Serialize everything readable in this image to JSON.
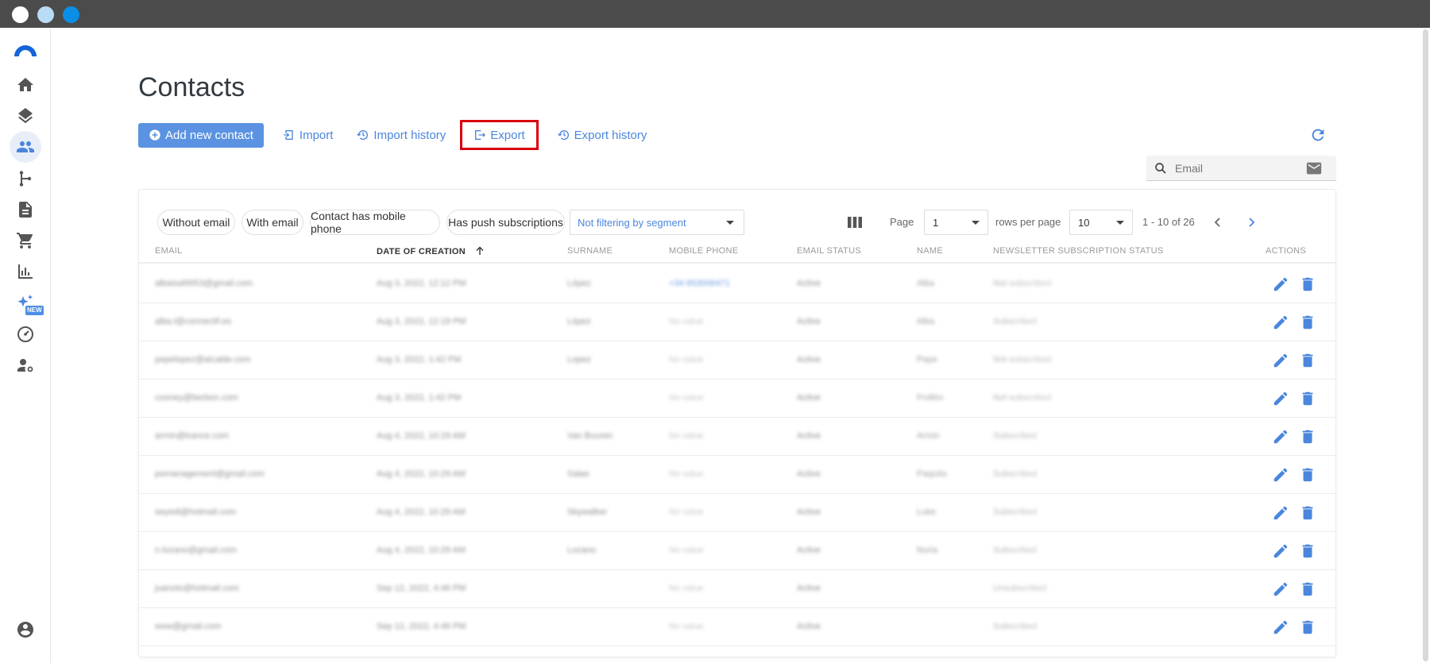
{
  "window": {
    "controls": [
      "close",
      "minimize",
      "maximize"
    ]
  },
  "sidebar": {
    "items": [
      {
        "icon": "home-icon"
      },
      {
        "icon": "layers-icon"
      },
      {
        "icon": "contacts-icon",
        "active": true
      },
      {
        "icon": "flow-icon"
      },
      {
        "icon": "document-icon"
      },
      {
        "icon": "cart-icon"
      },
      {
        "icon": "bar-chart-icon"
      },
      {
        "icon": "sparkles-icon",
        "badge": "NEW"
      },
      {
        "icon": "dashboard-icon"
      },
      {
        "icon": "user-settings-icon"
      }
    ],
    "bottom_icon": "account-icon"
  },
  "page": {
    "title": "Contacts"
  },
  "toolbar": {
    "add_label": "Add new contact",
    "import_label": "Import",
    "import_history_label": "Import history",
    "export_label": "Export",
    "export_history_label": "Export history"
  },
  "search": {
    "placeholder": "Email"
  },
  "filters": {
    "chips": [
      "Without email",
      "With email",
      "Contact has mobile phone",
      "Has push subscriptions"
    ],
    "segment": "Not filtering by segment"
  },
  "pagination": {
    "page_label": "Page",
    "page_value": "1",
    "rows_label": "rows per page",
    "rows_value": "10",
    "range": "1 - 10 of 26"
  },
  "table": {
    "columns": [
      "EMAIL",
      "DATE OF CREATION",
      "SURNAME",
      "MOBILE PHONE",
      "EMAIL STATUS",
      "NAME",
      "NEWSLETTER SUBSCRIPTION STATUS",
      "ACTIONS"
    ],
    "sorted_column": "DATE OF CREATION",
    "rows": [
      {
        "email": "albaisal9953@gmail.com",
        "date": "Aug 3, 2022, 12:12 PM",
        "surname": "López",
        "phone": "+34 653006471",
        "status": "Active",
        "name": "Alba",
        "newsletter": "Not subscribed"
      },
      {
        "email": "alba.l@connectif.es",
        "date": "Aug 3, 2022, 12:19 PM",
        "surname": "López",
        "phone": "No value",
        "status": "Active",
        "name": "Alba",
        "newsletter": "Subscribed"
      },
      {
        "email": "pepelopez@alcalde.com",
        "date": "Aug 3, 2022, 1:42 PM",
        "surname": "Lopez",
        "phone": "No value",
        "status": "Active",
        "name": "Pepe",
        "newsletter": "Not subscribed"
      },
      {
        "email": "cooney@berbon.com",
        "date": "Aug 3, 2022, 1:42 PM",
        "surname": "",
        "phone": "No value",
        "status": "Active",
        "name": "Frollón",
        "newsletter": "Not subscribed"
      },
      {
        "email": "armin@trance.com",
        "date": "Aug 4, 2022, 10:29 AM",
        "surname": "Van Buuren",
        "phone": "No value",
        "status": "Active",
        "name": "Armin",
        "newsletter": "Subscribed"
      },
      {
        "email": "pomanagement@gmail.com",
        "date": "Aug 4, 2022, 10:29 AM",
        "surname": "Salas",
        "phone": "No value",
        "status": "Active",
        "name": "Paquita",
        "newsletter": "Subscribed"
      },
      {
        "email": "seyedi@hotmail.com",
        "date": "Aug 4, 2022, 10:29 AM",
        "surname": "Skywalker",
        "phone": "No value",
        "status": "Active",
        "name": "Luke",
        "newsletter": "Subscribed"
      },
      {
        "email": "n.lozano@gmail.com",
        "date": "Aug 4, 2022, 10:29 AM",
        "surname": "Lozano",
        "phone": "No value",
        "status": "Active",
        "name": "Nuria",
        "newsletter": "Subscribed"
      },
      {
        "email": "juanolo@hotmail.com",
        "date": "Sep 12, 2022, 4:46 PM",
        "surname": "",
        "phone": "No value",
        "status": "Active",
        "name": "",
        "newsletter": "Unsubscribed"
      },
      {
        "email": "wow@gmail.com",
        "date": "Sep 12, 2022, 4:46 PM",
        "surname": "",
        "phone": "No value",
        "status": "Active",
        "name": "",
        "newsletter": "Subscribed"
      }
    ]
  },
  "colors": {
    "accent": "#5b93e2",
    "link": "#4a86dd",
    "highlight_border": "#d8000c",
    "titlebar": "#4b4b4b"
  }
}
